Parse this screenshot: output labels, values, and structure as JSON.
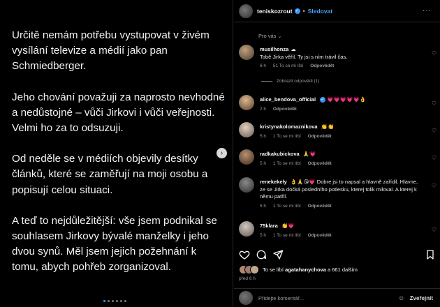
{
  "post": {
    "paragraphs": [
      "Určitě nemám potřebu vystupovat v živém vysílání televize a médií jako pan Schmiedberger.",
      "Jeho chování považuji za naprosto nevhodné a nedůstojné – vůči Jirkovi i vůči veřejnosti. Velmi ho za to odsuzuji.",
      "Od neděle se v médiích objevily desítky článků, které se zaměřují na moji osobu a popisují celou situaci.",
      "A teď to nejdůležitější: vše jsem podnikal se souhlasem Jirkovy bývalé manželky i jeho dvou synů. Měl jsem jejich požehnání k tomu, abych pohřeb zorganizoval."
    ],
    "slide_count": 6,
    "active_slide": 1
  },
  "header": {
    "username": "teniskozrout",
    "dot": "•",
    "follow_label": "Sledovat",
    "more": "···"
  },
  "sort_label": "Pro vás",
  "comments": [
    {
      "user": "musilhonza",
      "user_suffix": "☁",
      "text": "Tobě Jirka věřil. Ty jsi s ním trávil čas.",
      "time": "6 h",
      "likes": "51 To se mi líbí",
      "reply": "Odpovědět"
    },
    {
      "user": "alice_bendova_official",
      "text": "💗💗💗💗💗👌",
      "time": "2 h",
      "likes": "",
      "reply": "Odpovědět"
    },
    {
      "user": "kristynakolomaznikova",
      "text": "👏👏",
      "time": "5 h",
      "likes": "1 To se mi líbí",
      "reply": "Odpovědět"
    },
    {
      "user": "radkakubickova",
      "text": "🙏💗",
      "time": "5 h",
      "likes": "1 To se mi líbí",
      "reply": "Odpovědět"
    },
    {
      "user": "renekekely",
      "text": "👌🙏😘💗 Dobre jsi to napsal a hlavně zařídil. Hlavne, ze se Jirka dočká posledního potlesku, kterej tolik miloval. A kterej k němu patřil.",
      "time": "5 h",
      "likes": "1 To se mi líbí",
      "reply": "Odpovědět"
    },
    {
      "user": "75klara",
      "text": "👏💗",
      "time": "5 h",
      "likes": "1 To se mi líbí",
      "reply": "Odpovědět"
    }
  ],
  "view_replies": "Zobrazit odpovědi (1)",
  "likes": {
    "prefix": "To se líbí",
    "user": "agatahanychova",
    "suffix": "a 661 dalším"
  },
  "time_ago": "před 6 h",
  "add_comment": {
    "placeholder": "Přidejte komentář...",
    "post_label": "Zveřejnit"
  },
  "colors": {
    "accent": "#4a9ef5",
    "heart": "#ed4956",
    "background": "#000000"
  }
}
